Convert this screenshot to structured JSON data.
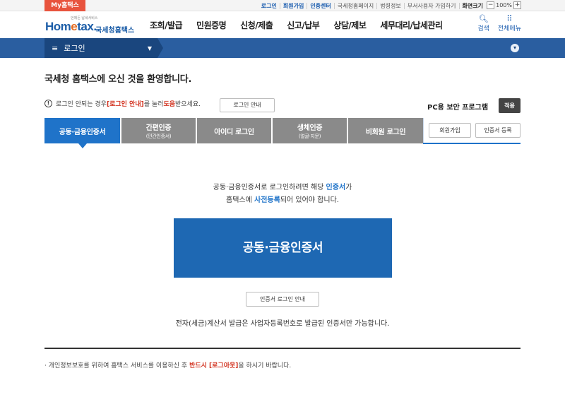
{
  "topbar": {
    "my_hometax": "My홈택스",
    "links": [
      {
        "label": "로그인",
        "style": "blue"
      },
      {
        "label": "회원가입",
        "style": "blue"
      },
      {
        "label": "인증센터",
        "style": "blue"
      },
      {
        "label": "국세청홈페이지",
        "style": "normal"
      },
      {
        "label": "법령정보",
        "style": "normal"
      },
      {
        "label": "부서사용자 가입하기",
        "style": "normal"
      },
      {
        "label": "화면크기",
        "style": "bold"
      }
    ],
    "zoom_minus": "−",
    "zoom_value": "100%",
    "zoom_plus": "+"
  },
  "header": {
    "slogan": "언제든 납세서비스",
    "logo_part1": "Hom",
    "logo_part2": "e",
    "logo_part3": "tax.",
    "logo_sub": "국세청홈택스",
    "nav": [
      "조회/발급",
      "민원증명",
      "신청/제출",
      "신고/납부",
      "상담/제보",
      "세무대리/납세관리"
    ],
    "search_label": "검색",
    "allmenu_label": "전체메뉴"
  },
  "navbar": {
    "breadcrumb": "로그인"
  },
  "main": {
    "welcome": "국세청 홈택스에 오신 것을 환영합니다.",
    "help_prefix": "로그인 안되는 경우 ",
    "help_link": "[로그인 안내]",
    "help_mid": "를 눌러 ",
    "help_emph": "도움",
    "help_suffix": "받으세요.",
    "guide_button": "로그인 안내",
    "pc_security": "PC용 보안 프로그램",
    "apply_button": "적용",
    "tabs": [
      {
        "label": "공동·금융인증서",
        "sub": ""
      },
      {
        "label": "간편인증",
        "sub": "(민간인증서)"
      },
      {
        "label": "아이디 로그인",
        "sub": ""
      },
      {
        "label": "생체인증",
        "sub": "(얼굴·지문)"
      },
      {
        "label": "비회원 로그인",
        "sub": ""
      }
    ],
    "join_button": "회원가입",
    "cert_register_button": "인증서 등록",
    "desc_line1_a": "공동·금융인증서로 로그인하려면 해당 ",
    "desc_line1_b": "인증서",
    "desc_line1_c": "가",
    "desc_line2_a": "홈택스에 ",
    "desc_line2_b": "사전등록",
    "desc_line2_c": "되어 있어야 합니다.",
    "big_button": "공동·금융인증서",
    "cert_guide_button": "인증서 로그인 안내",
    "notice": "전자(세금)계산서 발급은 사업자등록번호로 발급된 인증서만 가능합니다.",
    "foot_a": "· 개인정보보호를 위하여 홈택스 서비스를 이용하신 후 ",
    "foot_b": "반드시 [로그아웃]",
    "foot_c": "을 하시기 바랍니다."
  },
  "colors": {
    "brand_blue": "#1e68b3",
    "tab_active": "#1f73c9",
    "tab_inactive": "#8a8a8a",
    "nav_bar": "#2a5ea0",
    "accent_red": "#d2321f",
    "my_hometax": "#e8533d"
  },
  "icons": {
    "search": "search-icon",
    "allmenu": "grid-icon",
    "menu": "hamburger-icon",
    "warning": "exclamation-icon"
  }
}
